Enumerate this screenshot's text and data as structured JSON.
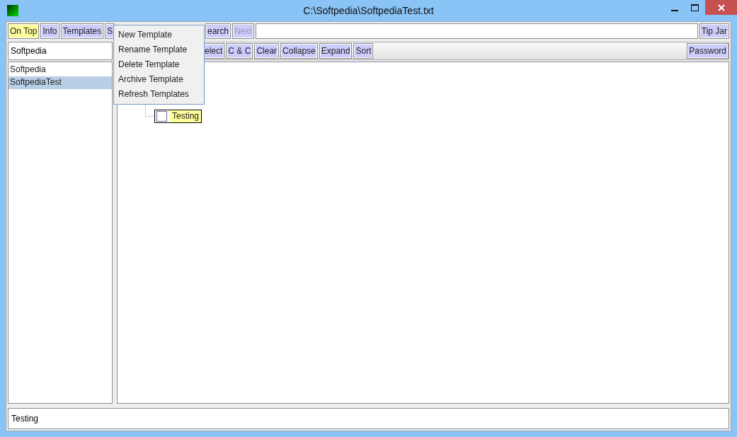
{
  "window": {
    "title": "C:\\Softpedia\\SoftpediaTest.txt"
  },
  "toolbar": {
    "left_buttons": [
      {
        "label": "On Top",
        "on": true,
        "disabled": false
      },
      {
        "label": "Info",
        "on": false,
        "disabled": false
      },
      {
        "label": "Templates",
        "on": false,
        "disabled": false
      },
      {
        "label": "S",
        "on": false,
        "disabled": false
      }
    ],
    "right_buttons": [
      {
        "label": "earch",
        "on": false,
        "disabled": false
      },
      {
        "label": "Next",
        "on": false,
        "disabled": true
      }
    ],
    "tip_jar": "Tip Jar"
  },
  "template_field": {
    "value": "Softpedia"
  },
  "tree_buttons": [
    "elect",
    "C & C",
    "Clear",
    "Collapse",
    "Expand",
    "Sort"
  ],
  "password_button": "Password",
  "templates": [
    {
      "label": "Softpedia",
      "selected": false
    },
    {
      "label": "SoftpediaTest",
      "selected": true
    }
  ],
  "tree": [
    {
      "label": "Testing",
      "checked": false
    }
  ],
  "menu": [
    "New Template",
    "Rename Template",
    "Delete Template",
    "Archive Template",
    "Refresh Templates"
  ],
  "status_field": {
    "value": "Testing"
  }
}
